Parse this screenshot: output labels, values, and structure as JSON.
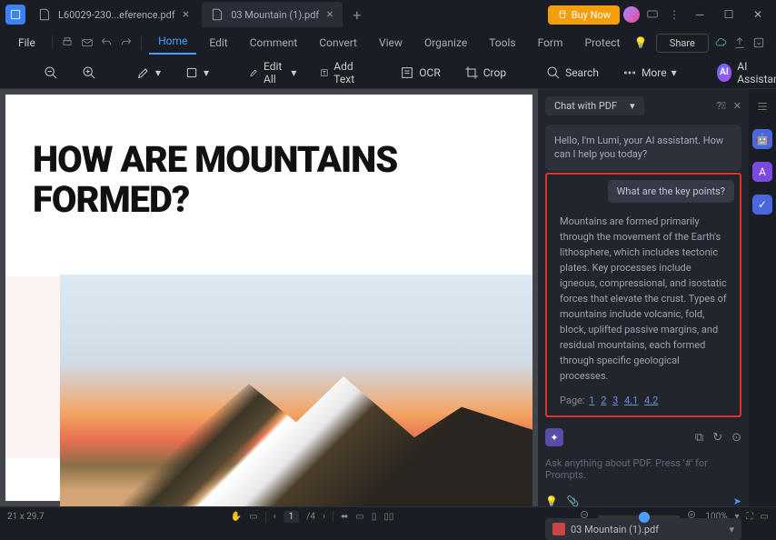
{
  "titlebar": {
    "tab1": "L60029-230...eference.pdf",
    "tab2": "03 Mountain (1).pdf",
    "buy_now": "Buy Now"
  },
  "menubar": {
    "file": "File",
    "items": [
      "Home",
      "Edit",
      "Comment",
      "Convert",
      "View",
      "Organize",
      "Tools",
      "Form",
      "Protect"
    ],
    "share": "Share"
  },
  "toolbar": {
    "edit_all": "Edit All",
    "add_text": "Add Text",
    "ocr": "OCR",
    "crop": "Crop",
    "search": "Search",
    "more": "More",
    "ai": "AI Assistant"
  },
  "document": {
    "heading": "HOW ARE MOUNTAINS FORMED?"
  },
  "ai_panel": {
    "chat_mode": "Chat with PDF",
    "greeting": "Hello, I'm Lumi, your AI assistant. How can I help you today?",
    "user_q": "What are the key points?",
    "answer": "Mountains are formed primarily through the movement of the Earth's lithosphere, which includes tectonic plates. Key processes include igneous, compressional, and isostatic forces that elevate the crust. Types of mountains include volcanic, fold, block, uplifted passive margins, and residual mountains, each formed through specific geological processes.",
    "page_label": "Page:",
    "page_links": [
      "1",
      "2",
      "3",
      "4.1",
      "4.2"
    ],
    "input_placeholder": "Ask anything about PDF. Press '#' for Prompts.",
    "file_chip": "03 Mountain (1).pdf"
  },
  "statusbar": {
    "dims": "21 x 29.7",
    "page_current": "1",
    "page_total": "/4",
    "zoom": "100%"
  }
}
